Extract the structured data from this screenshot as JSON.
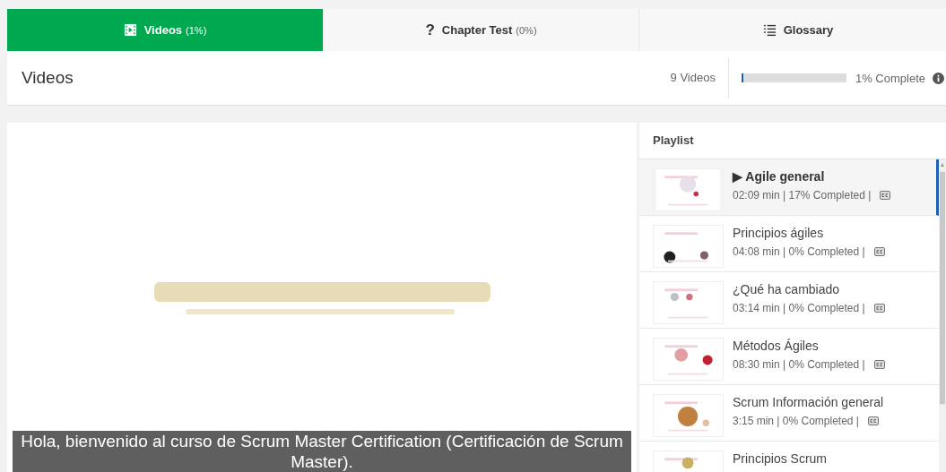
{
  "tabs": [
    {
      "kind": "video",
      "label": "Videos",
      "count": "(1%)",
      "selected": true
    },
    {
      "kind": "question",
      "icon_text": "?",
      "label": "Chapter Test",
      "count": "(0%)",
      "selected": false
    },
    {
      "kind": "list",
      "label": "Glossary",
      "selected": false
    }
  ],
  "header": {
    "title": "Videos",
    "video_count": "9 Videos",
    "progress": {
      "level": 0.01,
      "reading": "1% Complete"
    }
  },
  "player": {
    "kind": "picture",
    "caption": "Hola, bienvenido al curso de Scrum Master Certification (Certificación de Scrum Master)."
  },
  "playlist": {
    "title": "Playlist",
    "items": [
      {
        "title": "Agile general",
        "marker": "▶",
        "meta": "02:09 min | 17% Completed |",
        "captions": true,
        "selected": true
      },
      {
        "title": "Principios ágiles",
        "meta": "04:08 min | 0% Completed |",
        "captions": true,
        "selected": false
      },
      {
        "title": "¿Qué ha cambiado",
        "meta": "03:14 min | 0% Completed |",
        "captions": true,
        "selected": false
      },
      {
        "title": "Métodos Ágiles",
        "meta": "08:30 min | 0% Completed |",
        "captions": true,
        "selected": false
      },
      {
        "title": "Scrum Información general",
        "meta": "3:15 min | 0% Completed |",
        "captions": true,
        "selected": false
      },
      {
        "title": "Principios Scrum",
        "selected": false
      }
    ]
  }
}
